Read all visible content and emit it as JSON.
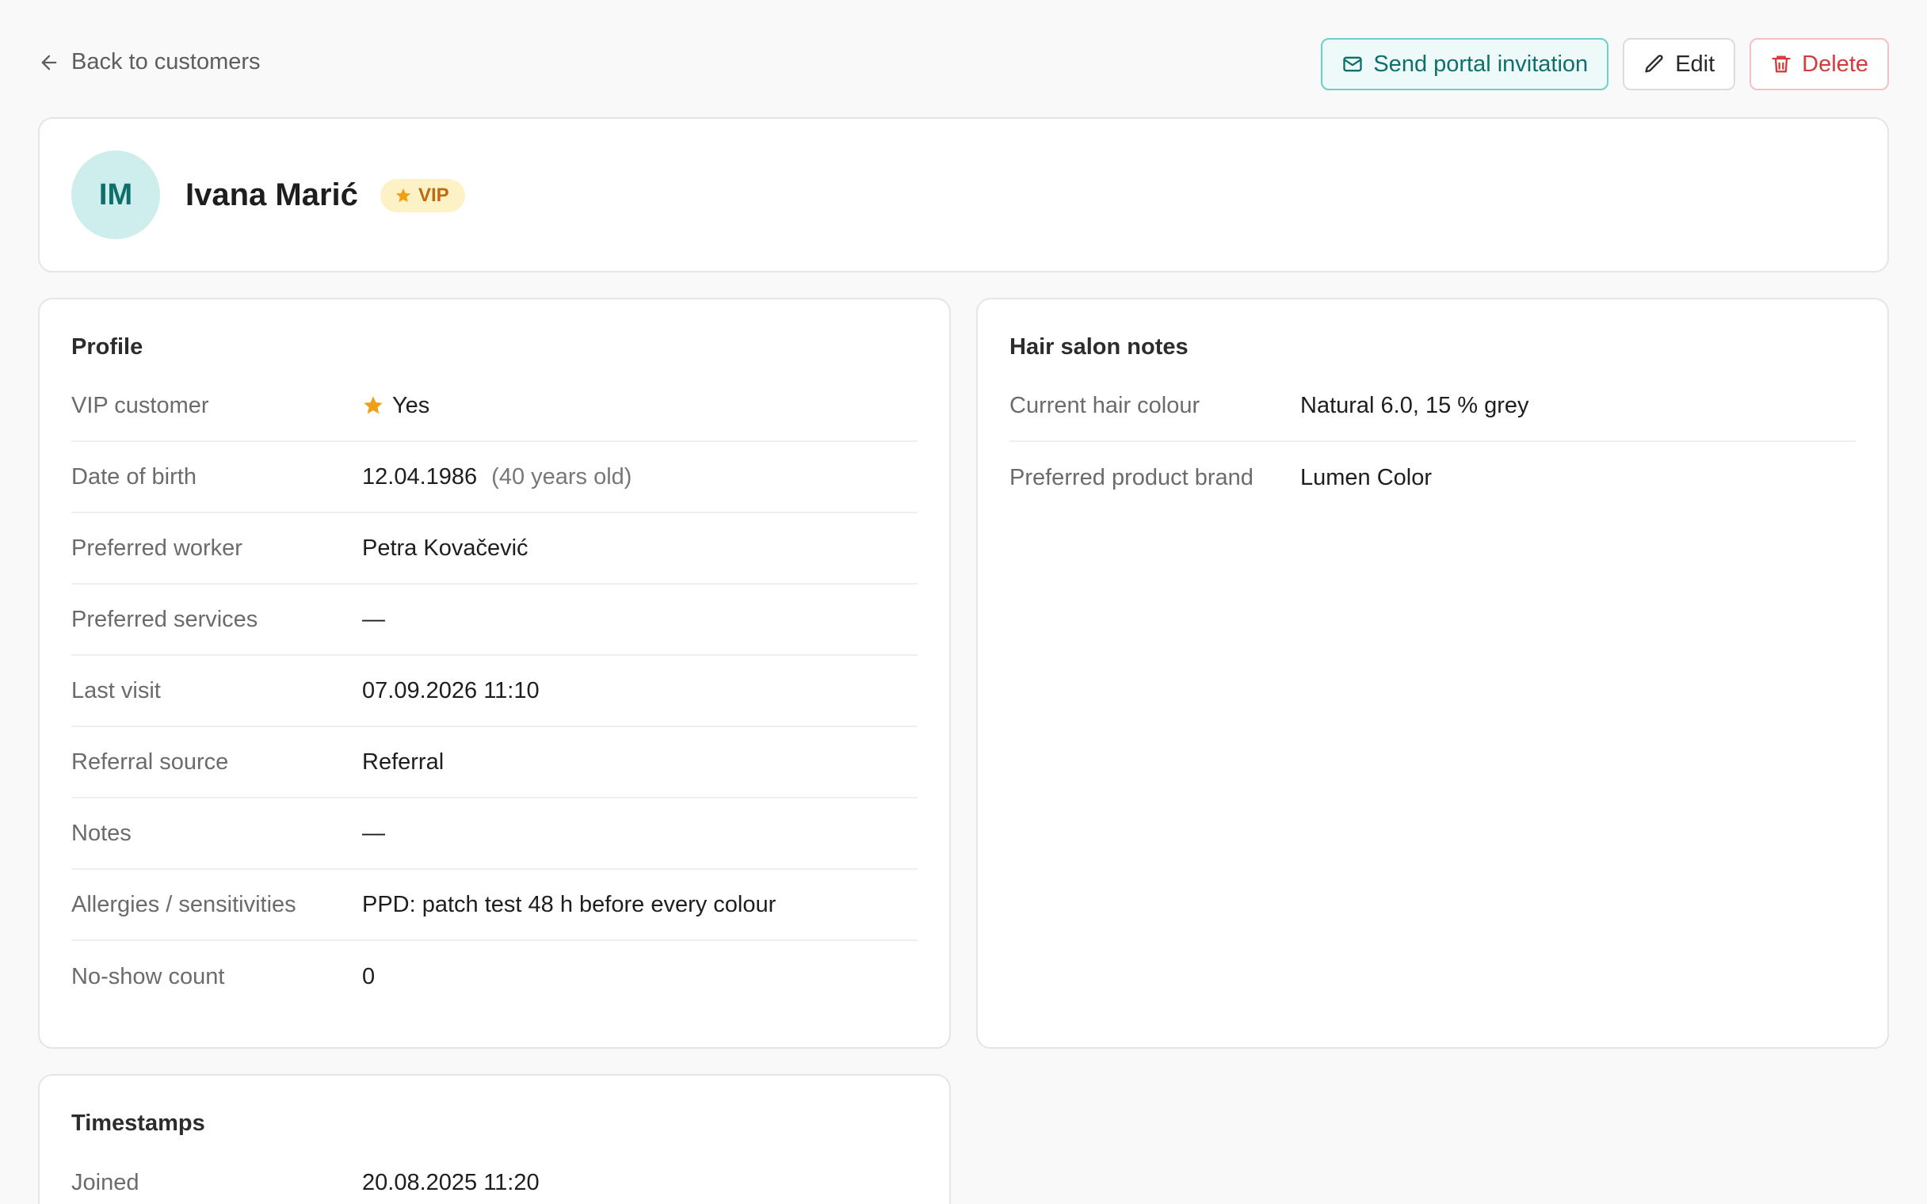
{
  "nav": {
    "back_label": "Back to customers"
  },
  "actions": {
    "invite_label": "Send portal invitation",
    "edit_label": "Edit",
    "delete_label": "Delete"
  },
  "customer": {
    "initials": "IM",
    "name": "Ivana Marić",
    "badge": "VIP"
  },
  "profile": {
    "title": "Profile",
    "rows": [
      {
        "label": "VIP customer",
        "value": "Yes"
      },
      {
        "label": "Date of birth",
        "value": "12.04.1986",
        "extra": "(40 years old)"
      },
      {
        "label": "Preferred worker",
        "value": "Petra Kovačević"
      },
      {
        "label": "Preferred services",
        "value": "—"
      },
      {
        "label": "Last visit",
        "value": "07.09.2026 11:10"
      },
      {
        "label": "Referral source",
        "value": "Referral"
      },
      {
        "label": "Notes",
        "value": "—"
      },
      {
        "label": "Allergies / sensitivities",
        "value": "PPD: patch test 48 h before every colour"
      },
      {
        "label": "No-show count",
        "value": "0"
      }
    ]
  },
  "salon_notes": {
    "title": "Hair salon notes",
    "rows": [
      {
        "label": "Current hair colour",
        "value": "Natural 6.0, 15 % grey"
      },
      {
        "label": "Preferred product brand",
        "value": "Lumen Color"
      }
    ]
  },
  "timestamps": {
    "title": "Timestamps",
    "rows": [
      {
        "label": "Joined",
        "value": "20.08.2025 11:20"
      }
    ]
  },
  "colors": {
    "accent": "#0f6f6a",
    "vip": "#f0a017",
    "danger": "#d43b3b"
  }
}
